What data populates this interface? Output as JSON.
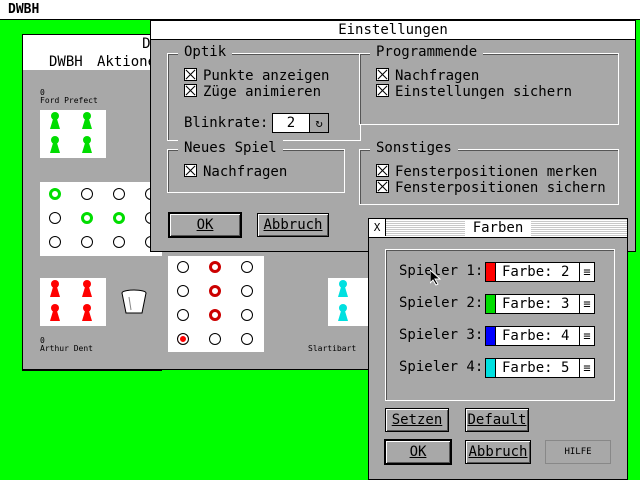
{
  "menubar": {
    "app": "DWBH"
  },
  "game_window": {
    "title": "Do",
    "menu": [
      "DWBH",
      "Aktione"
    ],
    "player_top": {
      "score": "0",
      "name": "Ford Prefect"
    },
    "player_bottom": {
      "score": "0",
      "name": "Arthur Dent"
    },
    "player_right": {
      "name": "Slartibart"
    }
  },
  "settings": {
    "title": "Einstellungen",
    "optik": {
      "title": "Optik",
      "items": [
        "Punkte anzeigen",
        "Züge animieren"
      ],
      "blink_label": "Blinkrate:",
      "blink_value": "2"
    },
    "programmende": {
      "title": "Programmende",
      "items": [
        "Nachfragen",
        "Einstellungen sichern"
      ]
    },
    "neues_spiel": {
      "title": "Neues Spiel",
      "items": [
        "Nachfragen"
      ]
    },
    "sonstiges": {
      "title": "Sonstiges",
      "items": [
        "Fensterpositionen merken",
        "Fensterpositionen sichern"
      ]
    },
    "ok_label": "OK",
    "cancel_label": "Abbruch"
  },
  "farben": {
    "title": "Farben",
    "close_glyph": "X",
    "players": [
      {
        "label": "Spieler 1:",
        "value": "Farbe: 2",
        "color": "#ff0000"
      },
      {
        "label": "Spieler 2:",
        "value": "Farbe: 3",
        "color": "#00dd00"
      },
      {
        "label": "Spieler 3:",
        "value": "Farbe: 4",
        "color": "#0000ff"
      },
      {
        "label": "Spieler 4:",
        "value": "Farbe: 5",
        "color": "#00e0e0"
      }
    ],
    "set_label": "Setzen",
    "default_label": "Default",
    "ok_label": "OK",
    "cancel_label": "Abbruch",
    "help_label": "HILFE"
  },
  "colors": {
    "desktop": "#00ff00",
    "window": "#a8a8a8",
    "red": "#ff0000",
    "green": "#00dd00",
    "cyan": "#00e0e0"
  }
}
